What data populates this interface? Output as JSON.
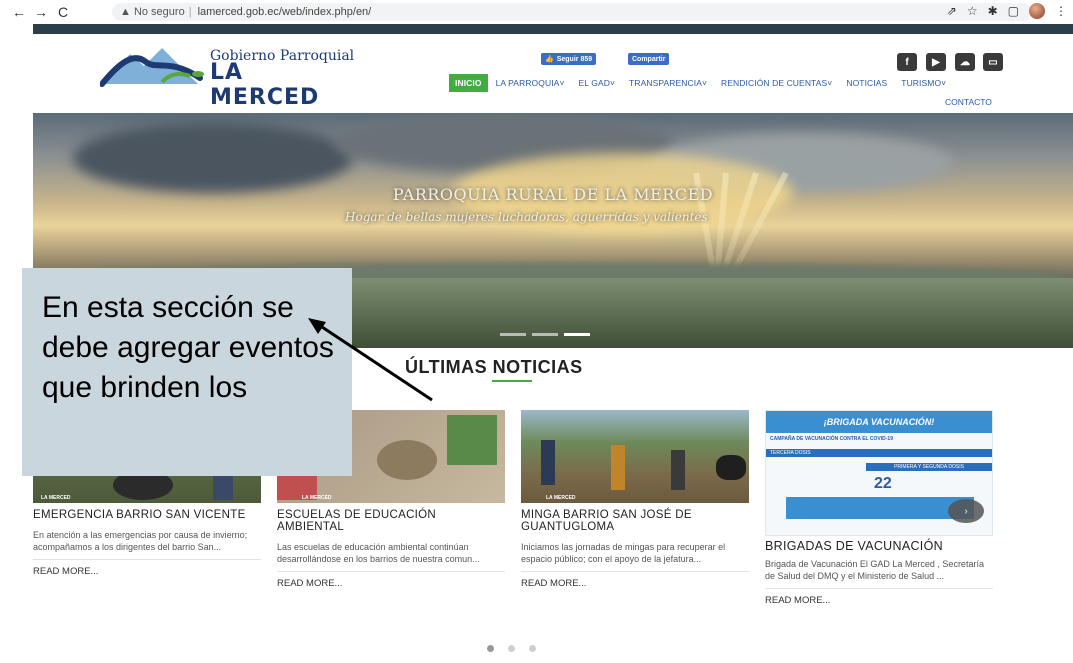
{
  "browser": {
    "nav_back": "←",
    "nav_forward": "→",
    "nav_reload": "C",
    "security_label": "▲ No seguro",
    "url": "lamerced.gob.ec/web/index.php/en/"
  },
  "logo": {
    "line1": "Gobierno Parroquial",
    "line2": "LA MERCED"
  },
  "social": {
    "follow_label": "Seguir 859",
    "share_label": "Compartir",
    "icons": [
      "facebook-icon",
      "youtube-icon",
      "cloud-icon",
      "chat-icon"
    ]
  },
  "nav": {
    "items": [
      {
        "label": "INICIO",
        "active": true
      },
      {
        "label": "LA PARROQUIA˅"
      },
      {
        "label": "EL GAD˅"
      },
      {
        "label": "TRANSPARENCIA˅"
      },
      {
        "label": "RENDICIÓN DE CUENTAS˅"
      },
      {
        "label": "NOTICIAS"
      },
      {
        "label": "TURISMO˅"
      }
    ],
    "contact": "CONTACTO"
  },
  "hero": {
    "title": "PARROQUIA RURAL DE LA MERCED",
    "subtitle": "Hogar de bellas mujeres luchadoras, aguerridas y valientes"
  },
  "annotation": {
    "text": "En esta sección se debe agregar eventos que brinden los"
  },
  "news": {
    "section_title": "ÚLTIMAS NOTICIAS",
    "cards": [
      {
        "title": "EMERGENCIA BARRIO SAN VICENTE",
        "text": "En atención a las emergencias por causa de invierno; acompañamos a los dirigentes del barrio San...",
        "more": "READ MORE...",
        "watermark": "LA MERCED"
      },
      {
        "title": "ESCUELAS DE EDUCACIÓN AMBIENTAL",
        "text": "Las escuelas de educación ambiental continúan desarrollándose en los barrios de nuestra comun...",
        "more": "READ MORE...",
        "watermark": "LA MERCED"
      },
      {
        "title": "MINGA BARRIO SAN JOSÉ DE GUANTUGLOMA",
        "text": "Iniciamos las jornadas de mingas para recuperar el espacio público; con el apoyo de la jefatura...",
        "more": "READ MORE...",
        "watermark": "LA MERCED"
      },
      {
        "title": "BRIGADAS DE VACUNACIÓN",
        "text": "Brigada de Vacunación El GAD La Merced , Secretaría de Salud del DMQ y el Ministerio de Salud ...",
        "more": "READ MORE...",
        "poster_heading": "¡BRIGADA VACUNACIÓN!",
        "poster_sub": "CAMPAÑA DE VACUNACIÓN CONTRA EL COVID-19",
        "poster_dose": "TERCERA DOSIS",
        "poster_dose2": "PRIMERA Y SEGUNDA DOSIS",
        "poster_date": "22"
      }
    ]
  },
  "colors": {
    "accent_green": "#3fae3f",
    "link_blue": "#2a5aa8",
    "logo_blue": "#1e3a73"
  }
}
